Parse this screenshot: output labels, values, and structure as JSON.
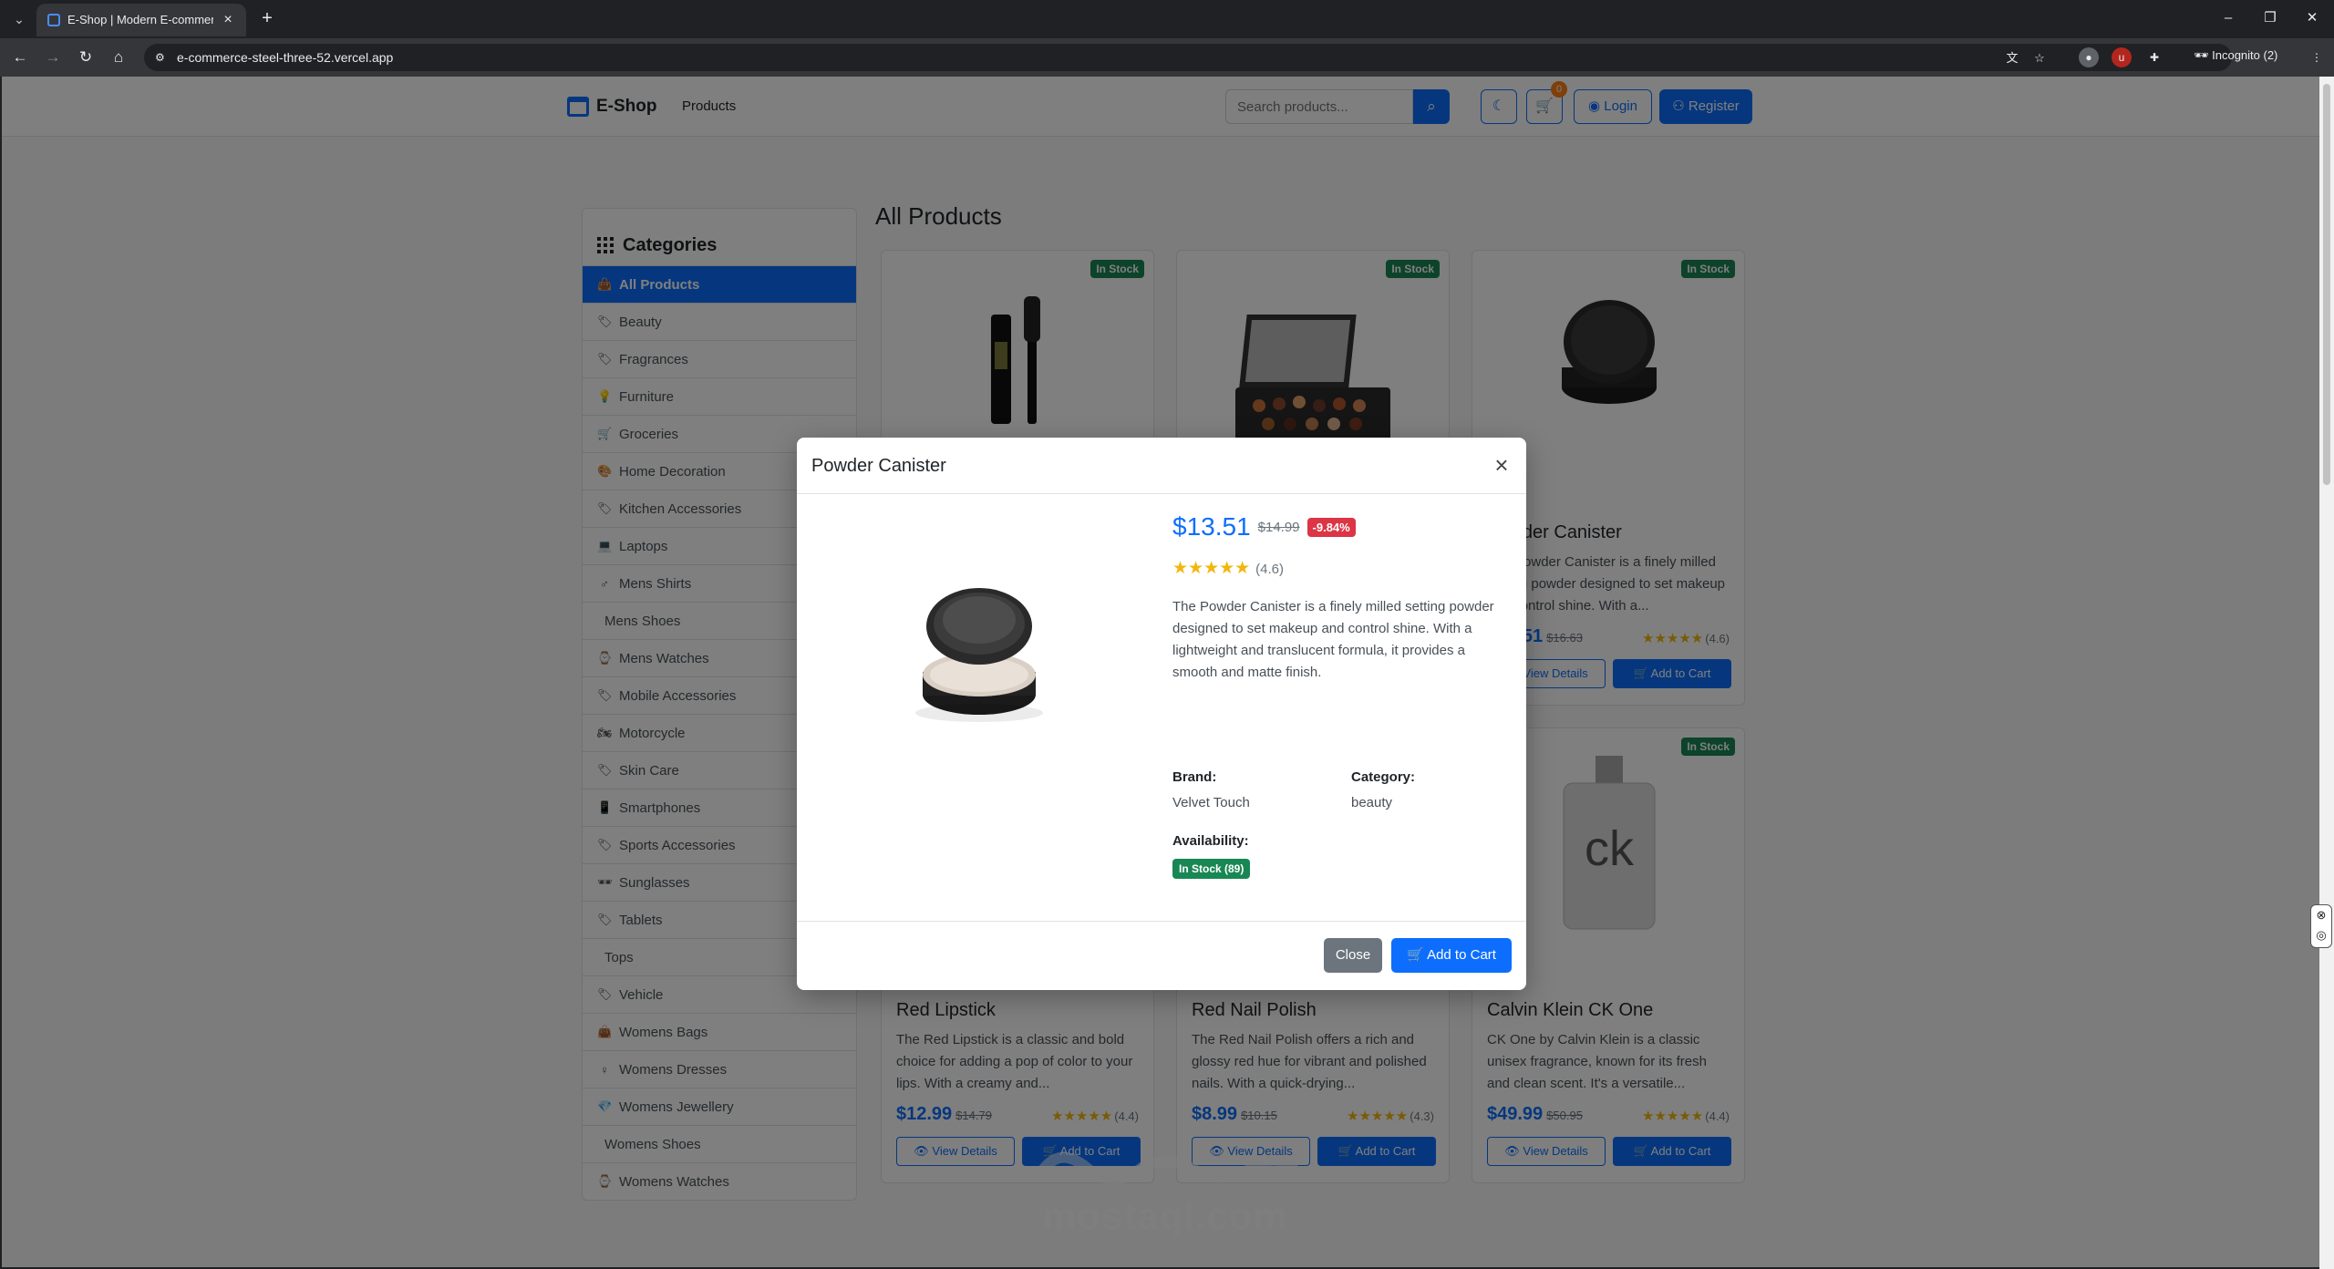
{
  "browser": {
    "tab_title": "E-Shop | Modern E-commerce",
    "url": "e-commerce-steel-three-52.vercel.app",
    "incognito_label": "Incognito (2)"
  },
  "navbar": {
    "brand": "E-Shop",
    "products_link": "Products",
    "search_placeholder": "Search products...",
    "cart_count": "0",
    "login": "Login",
    "register": "Register"
  },
  "sidebar": {
    "title": "Categories",
    "items": [
      {
        "label": "All Products",
        "icon": "bag-icon",
        "active": true
      },
      {
        "label": "Beauty",
        "icon": "tag-icon"
      },
      {
        "label": "Fragrances",
        "icon": "tag-icon"
      },
      {
        "label": "Furniture",
        "icon": "lamp-icon"
      },
      {
        "label": "Groceries",
        "icon": "cart-icon"
      },
      {
        "label": "Home Decoration",
        "icon": "palette-icon"
      },
      {
        "label": "Kitchen Accessories",
        "icon": "tag-icon"
      },
      {
        "label": "Laptops",
        "icon": "laptop-icon"
      },
      {
        "label": "Mens Shirts",
        "icon": "male-icon"
      },
      {
        "label": "Mens Shoes",
        "icon": ""
      },
      {
        "label": "Mens Watches",
        "icon": "watch-icon"
      },
      {
        "label": "Mobile Accessories",
        "icon": "tag-icon"
      },
      {
        "label": "Motorcycle",
        "icon": "motorcycle-icon"
      },
      {
        "label": "Skin Care",
        "icon": "tag-icon"
      },
      {
        "label": "Smartphones",
        "icon": "phone-icon"
      },
      {
        "label": "Sports Accessories",
        "icon": "tag-icon"
      },
      {
        "label": "Sunglasses",
        "icon": "glasses-icon"
      },
      {
        "label": "Tablets",
        "icon": "tag-icon"
      },
      {
        "label": "Tops",
        "icon": ""
      },
      {
        "label": "Vehicle",
        "icon": "tag-icon"
      },
      {
        "label": "Womens Bags",
        "icon": "bag-icon"
      },
      {
        "label": "Womens Dresses",
        "icon": "female-icon"
      },
      {
        "label": "Womens Jewellery",
        "icon": "gem-icon"
      },
      {
        "label": "Womens Shoes",
        "icon": ""
      },
      {
        "label": "Womens Watches",
        "icon": "watch-icon"
      }
    ]
  },
  "main": {
    "section_title": "All Products",
    "in_stock_label": "In Stock",
    "view_details_label": "View Details",
    "add_to_cart_label": "Add to Cart",
    "products": [
      {
        "name": "",
        "desc": "",
        "price": "",
        "old": "",
        "rating": "",
        "image": "mascara"
      },
      {
        "name": "",
        "desc": "",
        "price": "",
        "old": "",
        "rating": "",
        "image": "eyeshadow-palette"
      },
      {
        "name": "Powder Canister",
        "desc": "The Powder Canister is a finely milled setting powder designed to set makeup and control shine. With a...",
        "price": "$13.51",
        "old": "$16.63",
        "rating": "(4.6)",
        "image": "powder"
      },
      {
        "name": "Red Lipstick",
        "desc": "The Red Lipstick is a classic and bold choice for adding a pop of color to your lips. With a creamy and...",
        "price": "$12.99",
        "old": "$14.79",
        "rating": "(4.4)",
        "image": "lipstick"
      },
      {
        "name": "Red Nail Polish",
        "desc": "The Red Nail Polish offers a rich and glossy red hue for vibrant and polished nails. With a quick-drying...",
        "price": "$8.99",
        "old": "$10.15",
        "rating": "(4.3)",
        "image": "nail-polish"
      },
      {
        "name": "Calvin Klein CK One",
        "desc": "CK One by Calvin Klein is a classic unisex fragrance, known for its fresh and clean scent. It's a versatile...",
        "price": "$49.99",
        "old": "$50.95",
        "rating": "(4.4)",
        "image": "perfume"
      }
    ]
  },
  "modal": {
    "title": "Powder Canister",
    "price": "$13.51",
    "old_price": "$14.99",
    "discount": "-9.84%",
    "rating_text": "(4.6)",
    "rating_value": 4.6,
    "description": "The Powder Canister is a finely milled setting powder designed to set makeup and control shine. With a lightweight and translucent formula, it provides a smooth and matte finish.",
    "brand_label": "Brand:",
    "brand": "Velvet Touch",
    "category_label": "Category:",
    "category": "beauty",
    "availability_label": "Availability:",
    "stock_badge": "In Stock (89)",
    "close_button": "Close",
    "add_to_cart_button": "Add to Cart"
  },
  "watermark": {
    "latin": "mostaql.com"
  },
  "colors": {
    "primary": "#0d6efd",
    "success": "#198754",
    "danger": "#dc3545",
    "secondary": "#6c757d",
    "star": "#f1b70e"
  }
}
